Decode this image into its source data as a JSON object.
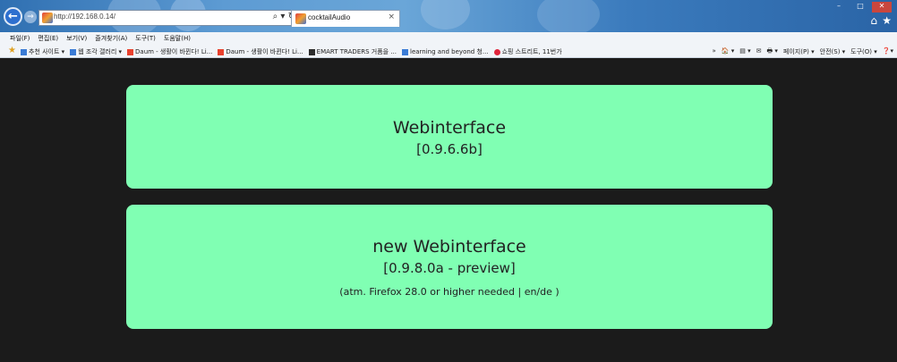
{
  "browser": {
    "url": "http://192.168.0.14/",
    "address_icons": "⌕ ▾ ↻",
    "tab_title": "cocktailAudio",
    "tab_close": "×",
    "back_glyph": "←",
    "forward_glyph": "→",
    "home_glyph": "⌂",
    "star_glyph": "★",
    "window_controls": {
      "minimize": "–",
      "maximize": "□",
      "close": "✕"
    }
  },
  "menubar": [
    "파일(F)",
    "편집(E)",
    "보기(V)",
    "즐겨찾기(A)",
    "도구(T)",
    "도움말(H)"
  ],
  "favorites": [
    {
      "label": "추천 사이트 ▾",
      "icon_color": "#3a7bd5"
    },
    {
      "label": "웹 조각 갤러리 ▾",
      "icon_color": "#3a7bd5"
    },
    {
      "label": "Daum - 생활이 바뀐다! Li...",
      "icon_color": "#e8412e"
    },
    {
      "label": "Daum - 생활이 바뀐다! Li...",
      "icon_color": "#e8412e"
    },
    {
      "label": "EMART TRADERS 거품을 ...",
      "icon_color": "#2d2d2d"
    },
    {
      "label": "learning and beyond 청...",
      "icon_color": "#3a7bd5"
    },
    {
      "label": "쇼핑 스트리트, 11번가",
      "icon_color": "#e0243b"
    }
  ],
  "tools": [
    "»",
    "🏠 ▾",
    "▤ ▾",
    "✉",
    "🖶 ▾",
    "페이지(P) ▾",
    "안전(S) ▾",
    "도구(O) ▾",
    "❓▾"
  ],
  "cards": [
    {
      "title": "Webinterface",
      "version": "[0.9.6.6b]"
    },
    {
      "title": "new Webinterface",
      "version": "[0.9.8.0a - preview]",
      "note": "(atm. Firefox 28.0 or higher needed | en/de )"
    }
  ],
  "colors": {
    "card_background": "#80ffb3",
    "page_background": "#1b1b1b"
  }
}
